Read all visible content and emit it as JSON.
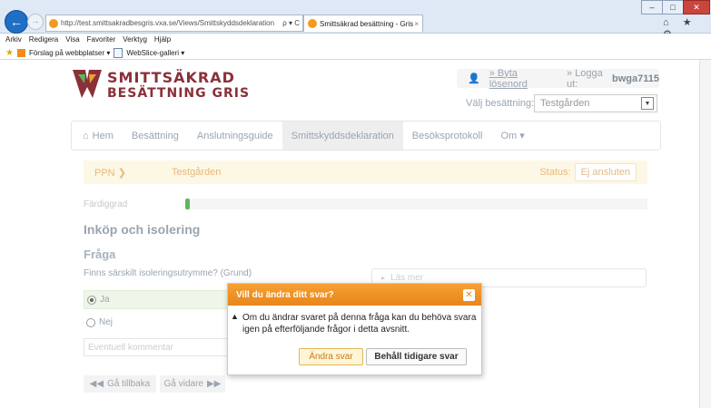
{
  "browser": {
    "url": "http://test.smittsakradbesgris.vxa.se/Views/Smittskyddsdeklaration",
    "url_controls": "ρ ▾ C",
    "tab_title": "Smittsäkrad besättning - Gris",
    "tab_close": "×",
    "menu": [
      "Arkiv",
      "Redigera",
      "Visa",
      "Favoriter",
      "Verktyg",
      "Hjälp"
    ],
    "favorites": [
      "Förslag på webbplatser ▾",
      "WebSlice-galleri ▾"
    ],
    "right_icons": "⌂ ★ ⚙"
  },
  "brand": {
    "line1": "SMITTSÄKRAD",
    "line2": "BESÄTTNING GRIS",
    "color": "#8a3039",
    "accent": "#e8851a"
  },
  "account": {
    "change_password": "» Byta lösenord",
    "logout_prefix": "» Logga ut:",
    "username": "bwga7115"
  },
  "herd_select": {
    "label": "Välj besättning:",
    "value": "Testgården"
  },
  "nav": {
    "items": [
      "Hem",
      "Besättning",
      "Anslutningsguide",
      "Smittskyddsdeklaration",
      "Besöksprotokoll",
      "Om ▾"
    ],
    "active_index": 3
  },
  "ppn": {
    "label": "PPN",
    "farm": "Testgården",
    "status_label": "Status:",
    "status_value": "Ej ansluten"
  },
  "progress": {
    "label": "Färdiggrad",
    "value_percent": 1
  },
  "section_title": "Inköp och isolering",
  "question": {
    "heading": "Fråga",
    "text": "Finns särskilt isoleringsutrymme? (Grund)",
    "read_more": "Läs mer",
    "options": [
      "Ja",
      "Nej"
    ],
    "selected": "Ja",
    "comment_placeholder": "Eventuell kommentar"
  },
  "buttons": {
    "back": "Gå tillbaka",
    "next": "Gå vidare"
  },
  "dialog": {
    "title": "Vill du ändra ditt svar?",
    "message": "Om du ändrar svaret på denna fråga kan du behöva svara igen på efterföljande frågor i detta avsnitt.",
    "confirm": "Ändra svar",
    "cancel": "Behåll tidigare svar"
  }
}
